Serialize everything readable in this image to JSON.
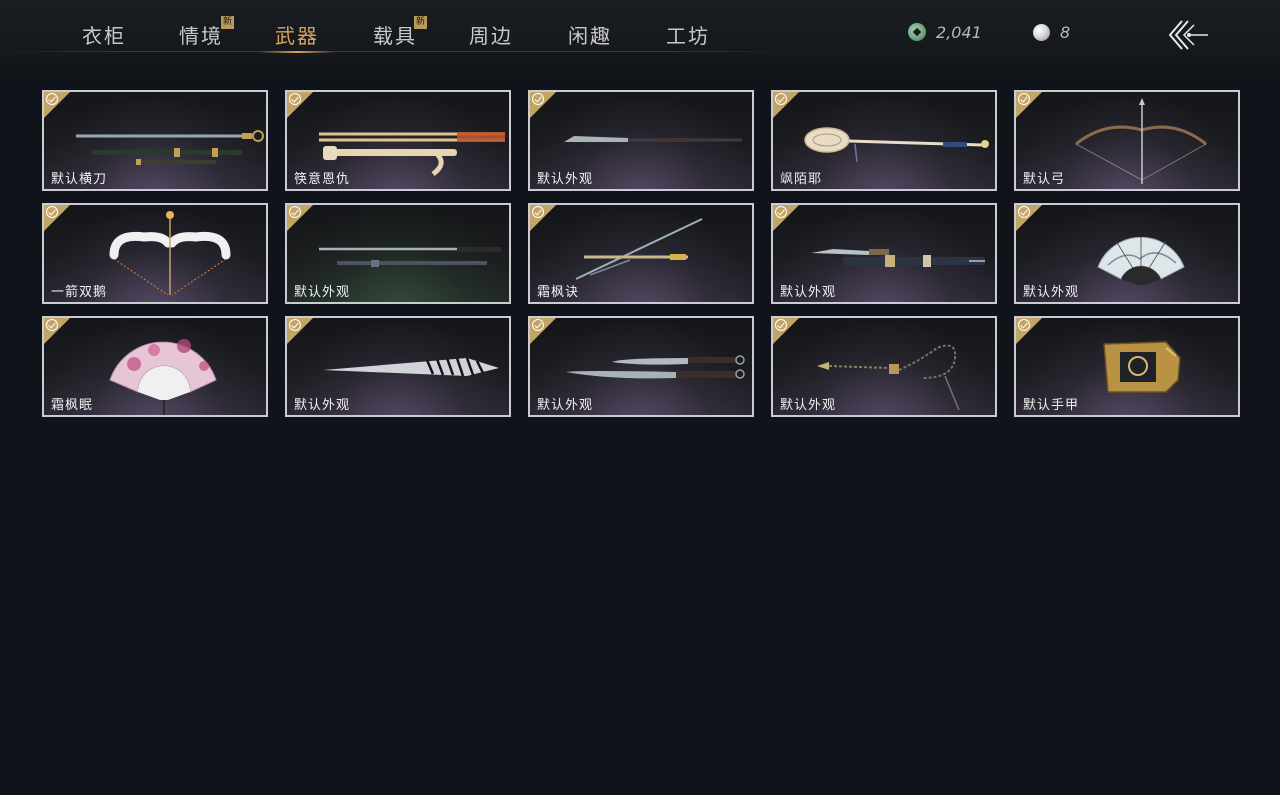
{
  "tabs": [
    {
      "label": "衣柜",
      "active": false,
      "new": false
    },
    {
      "label": "情境",
      "active": false,
      "new": true
    },
    {
      "label": "武器",
      "active": true,
      "new": false
    },
    {
      "label": "载具",
      "active": false,
      "new": true
    },
    {
      "label": "周边",
      "active": false,
      "new": false
    },
    {
      "label": "闲趣",
      "active": false,
      "new": false
    },
    {
      "label": "工坊",
      "active": false,
      "new": false
    }
  ],
  "new_badge": "新",
  "currency": {
    "jade": {
      "icon": "jade-coin-icon",
      "value": "2,041"
    },
    "pearl": {
      "icon": "pearl-icon",
      "value": "8"
    }
  },
  "back_icon": "back-arrow-icon",
  "colors": {
    "accent": "#d7a55a",
    "check": "#c4a465",
    "card_border": "#c9cdd3",
    "bg": "#10141a"
  },
  "items": [
    {
      "label": "默认横刀",
      "icon": "saber-icon",
      "owned": true
    },
    {
      "label": "筷意恩仇",
      "icon": "chopsticks-icon",
      "owned": true
    },
    {
      "label": "默认外观",
      "icon": "glaive-icon",
      "owned": true
    },
    {
      "label": "飒陌耶",
      "icon": "ladle-staff-icon",
      "owned": true
    },
    {
      "label": "默认弓",
      "icon": "bow-icon",
      "owned": true
    },
    {
      "label": "一箭双鹅",
      "icon": "goose-bow-icon",
      "owned": true
    },
    {
      "label": "默认外观",
      "icon": "twin-swords-icon",
      "owned": true
    },
    {
      "label": "霜枫诀",
      "icon": "crossed-spears-icon",
      "owned": true
    },
    {
      "label": "默认外观",
      "icon": "dagger-sheath-icon",
      "owned": true
    },
    {
      "label": "默认外观",
      "icon": "landscape-fan-icon",
      "owned": true
    },
    {
      "label": "霜枫眠",
      "icon": "plum-fan-icon",
      "owned": true
    },
    {
      "label": "默认外观",
      "icon": "closed-fan-icon",
      "owned": true
    },
    {
      "label": "默认外观",
      "icon": "dual-blades-icon",
      "owned": true
    },
    {
      "label": "默认外观",
      "icon": "rope-dart-icon",
      "owned": true
    },
    {
      "label": "默认手甲",
      "icon": "gauntlet-icon",
      "owned": true
    }
  ]
}
